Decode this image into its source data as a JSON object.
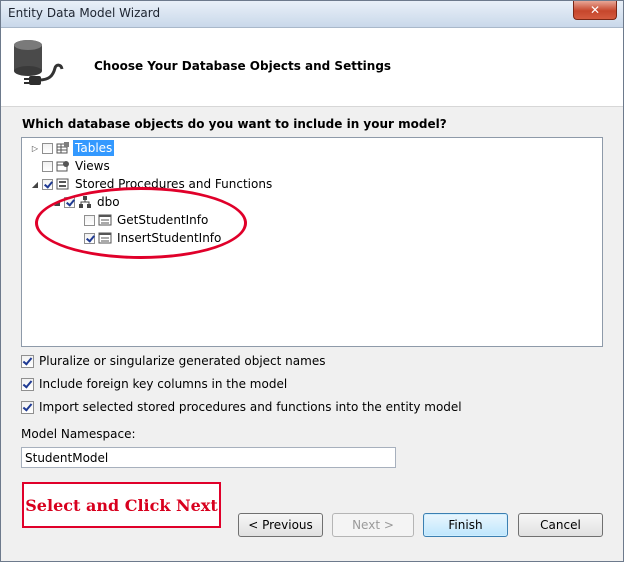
{
  "window": {
    "title": "Entity Data Model Wizard",
    "close_glyph": "✕"
  },
  "header": {
    "title": "Choose Your Database Objects and Settings",
    "icon": "database-plug-icon"
  },
  "prompt": "Which database objects do you want to include in your model?",
  "tree": {
    "items": [
      {
        "label": "Tables",
        "checked": false,
        "expanded": false,
        "selected": true,
        "icon": "table-group-icon"
      },
      {
        "label": "Views",
        "checked": false,
        "icon": "view-group-icon"
      },
      {
        "label": "Stored Procedures and Functions",
        "checked": true,
        "expanded": true,
        "icon": "procedure-group-icon"
      },
      {
        "label": "dbo",
        "checked": true,
        "expanded": true,
        "icon": "schema-icon"
      },
      {
        "label": "GetStudentInfo",
        "checked": false,
        "icon": "procedure-icon"
      },
      {
        "label": "InsertStudentInfo",
        "checked": true,
        "icon": "procedure-icon"
      }
    ]
  },
  "options": [
    {
      "label": "Pluralize or singularize generated object names",
      "checked": true
    },
    {
      "label": "Include foreign key columns in the model",
      "checked": true
    },
    {
      "label": "Import selected stored procedures and functions into the entity model",
      "checked": true
    }
  ],
  "namespace": {
    "label": "Model Namespace:",
    "value": "StudentModel"
  },
  "annotation": {
    "text": "Select and Click Next",
    "color": "#d8001e"
  },
  "buttons": {
    "previous": "< Previous",
    "next": "Next >",
    "finish": "Finish",
    "cancel": "Cancel"
  }
}
